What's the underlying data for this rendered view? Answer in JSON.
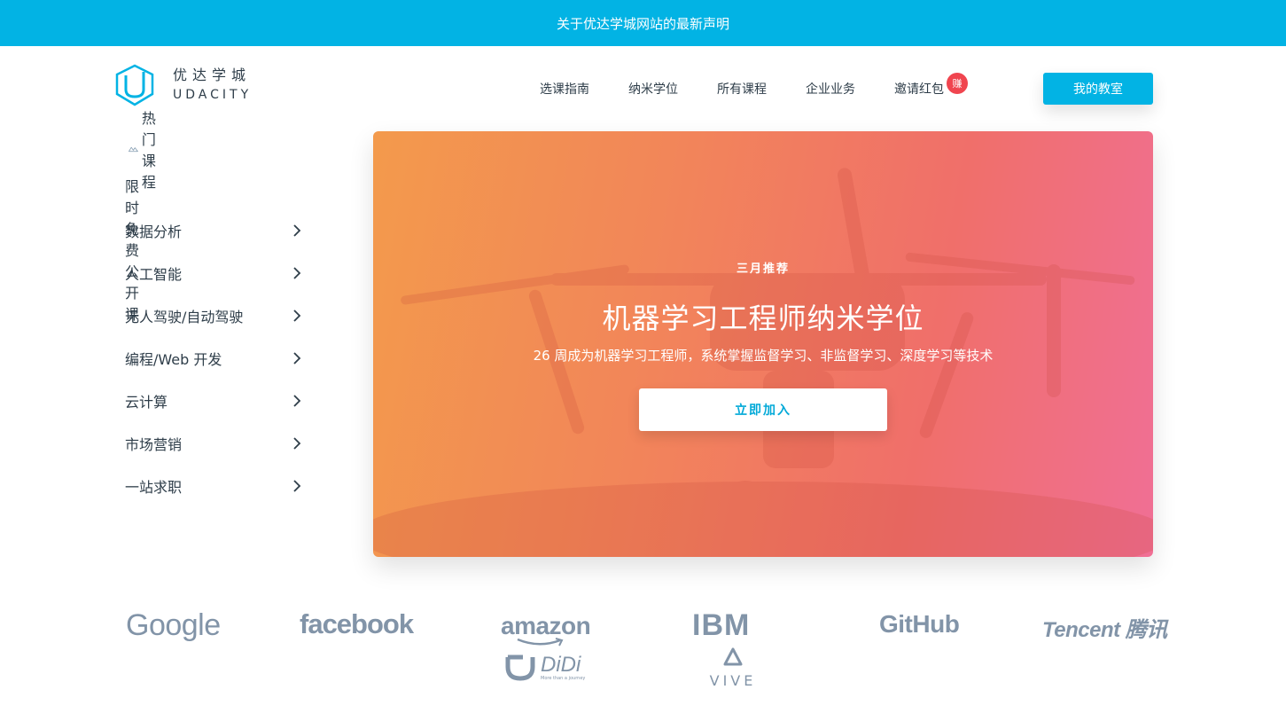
{
  "announcement": "关于优达学城网站的最新声明",
  "logo": {
    "cn": "优达学城",
    "en": "UDACITY"
  },
  "nav": {
    "items": [
      "选课指南",
      "纳米学位",
      "所有课程",
      "企业业务",
      "邀请红包"
    ],
    "badge": "赚",
    "classroom_button": "我的教室"
  },
  "sidebar": {
    "hot_label": "热门课程",
    "free_label": "限时免费公开课",
    "items": [
      "数据分析",
      "人工智能",
      "无人驾驶/自动驾驶",
      "编程/Web 开发",
      "云计算",
      "市场营销",
      "一站求职"
    ]
  },
  "hero": {
    "tag": "三月推荐",
    "title": "机器学习工程师纳米学位",
    "subtitle": "26 周成为机器学习工程师，系统掌握监督学习、非监督学习、深度学习等技术",
    "button": "立即加入",
    "colors": {
      "start": "#f39a4c",
      "end": "#f06f95"
    }
  },
  "partners": {
    "google": "Google",
    "facebook": "facebook",
    "amazon": "amazon",
    "ibm": "IBM",
    "github": "GitHub",
    "tencent": "Tencent 腾讯",
    "didi": "DiDi",
    "didi_tagline": "More than a journey",
    "vive": "VIVE"
  },
  "colors": {
    "accent": "#02b3e4",
    "text": "#2e3d49",
    "badge": "#f0454f",
    "partner": "#8294a8"
  }
}
